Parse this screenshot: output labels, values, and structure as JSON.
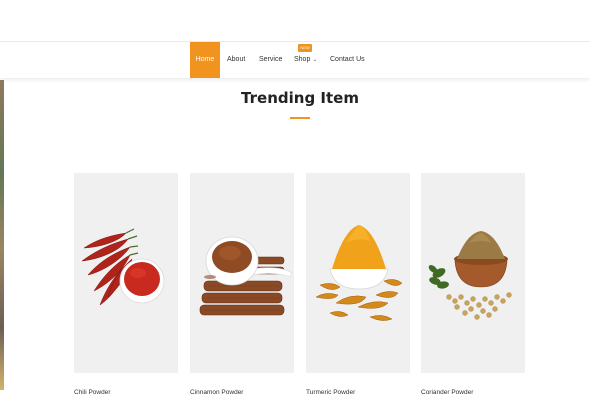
{
  "nav": {
    "items": [
      {
        "label": "Home",
        "active": true
      },
      {
        "label": "About",
        "active": false
      },
      {
        "label": "Service",
        "active": false
      },
      {
        "label": "Shop",
        "active": false
      },
      {
        "label": "Contact Us",
        "active": false
      }
    ],
    "badge": "NEW"
  },
  "section": {
    "title": "Trending Item"
  },
  "products": [
    {
      "name": "Chili Powder",
      "icon": "chili-powder-image"
    },
    {
      "name": "Cinnamon Powder",
      "icon": "cinnamon-powder-image"
    },
    {
      "name": "Turmeric Powder",
      "icon": "turmeric-powder-image"
    },
    {
      "name": "Coriander Powder",
      "icon": "coriander-powder-image"
    }
  ],
  "colors": {
    "accent": "#f0931f",
    "card_bg": "#f0f0f1",
    "text": "#333333"
  }
}
